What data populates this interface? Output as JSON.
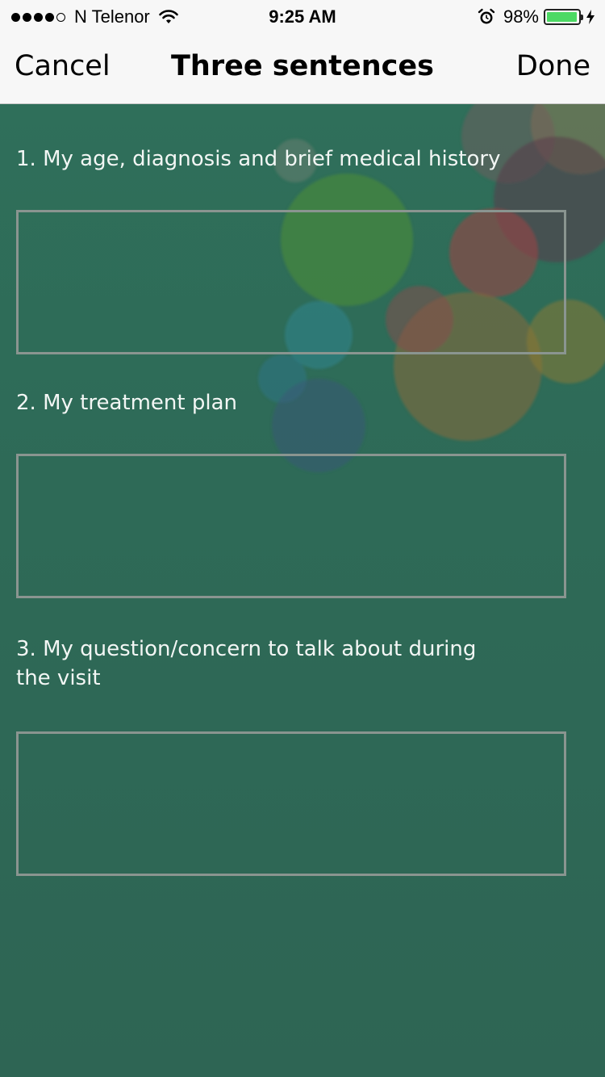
{
  "status_bar": {
    "carrier": "N Telenor",
    "time": "9:25 AM",
    "battery_percent": "98%",
    "battery_level": 0.98,
    "battery_color": "#4cd964",
    "signal_bars_filled": 4,
    "signal_bars_total": 5,
    "icons": [
      "wifi-icon",
      "alarm-icon",
      "battery-icon",
      "charging-bolt-icon"
    ]
  },
  "nav": {
    "cancel_label": "Cancel",
    "title": "Three sentences",
    "done_label": "Done"
  },
  "form": {
    "questions": [
      {
        "label": "1. My age, diagnosis and brief medical history",
        "value": ""
      },
      {
        "label": "2. My treatment plan",
        "value": ""
      },
      {
        "label": "3. My question/concern to talk about during the visit",
        "value": ""
      }
    ]
  },
  "colors": {
    "background": "#2f6b58",
    "text": "#f2f6f4",
    "box_border": "#8a9590"
  }
}
